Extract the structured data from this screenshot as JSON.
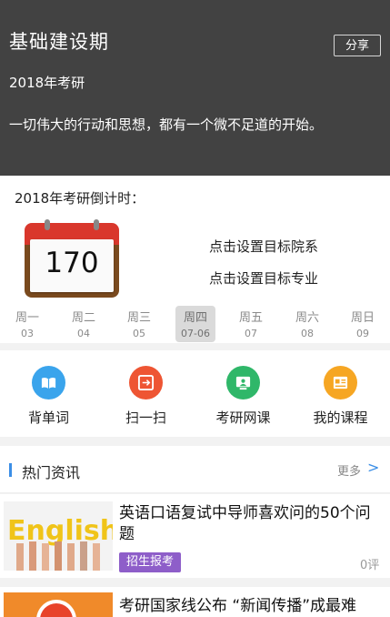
{
  "header": {
    "title": "基础建设期",
    "share_label": "分享",
    "subtitle": "2018年考研",
    "quote": "一切伟大的行动和思想，都有一个微不足道的开始。"
  },
  "countdown": {
    "label": "2018年考研倒计时：",
    "days": "170",
    "set_school": "点击设置目标院系",
    "set_major": "点击设置目标专业",
    "weekdays": [
      {
        "name": "周一",
        "date": "03"
      },
      {
        "name": "周二",
        "date": "04"
      },
      {
        "name": "周三",
        "date": "05"
      },
      {
        "name": "周四",
        "date": "07-06"
      },
      {
        "name": "周五",
        "date": "07"
      },
      {
        "name": "周六",
        "date": "08"
      },
      {
        "name": "周日",
        "date": "09"
      }
    ],
    "active_index": 3
  },
  "menu": {
    "items": [
      {
        "label": "背单词",
        "icon": "book-icon",
        "color": "#3aa4ec"
      },
      {
        "label": "扫一扫",
        "icon": "scan-icon",
        "color": "#ee5533"
      },
      {
        "label": "考研网课",
        "icon": "online-course-icon",
        "color": "#2fb769"
      },
      {
        "label": "我的课程",
        "icon": "my-courses-icon",
        "color": "#f6a623"
      }
    ]
  },
  "news": {
    "title": "热门资讯",
    "more": "更多",
    "items": [
      {
        "headline": "英语口语复试中导师喜欢问的50个问题",
        "tag": "招生报考",
        "comments": "0评",
        "thumb_text": "English"
      },
      {
        "headline": "考研国家线公布 “新闻传播”成最难"
      }
    ]
  },
  "colors": {
    "header_bg": "#424242",
    "accent_blue": "#3b8ee6",
    "tag_purple": "#8e5ec9"
  }
}
